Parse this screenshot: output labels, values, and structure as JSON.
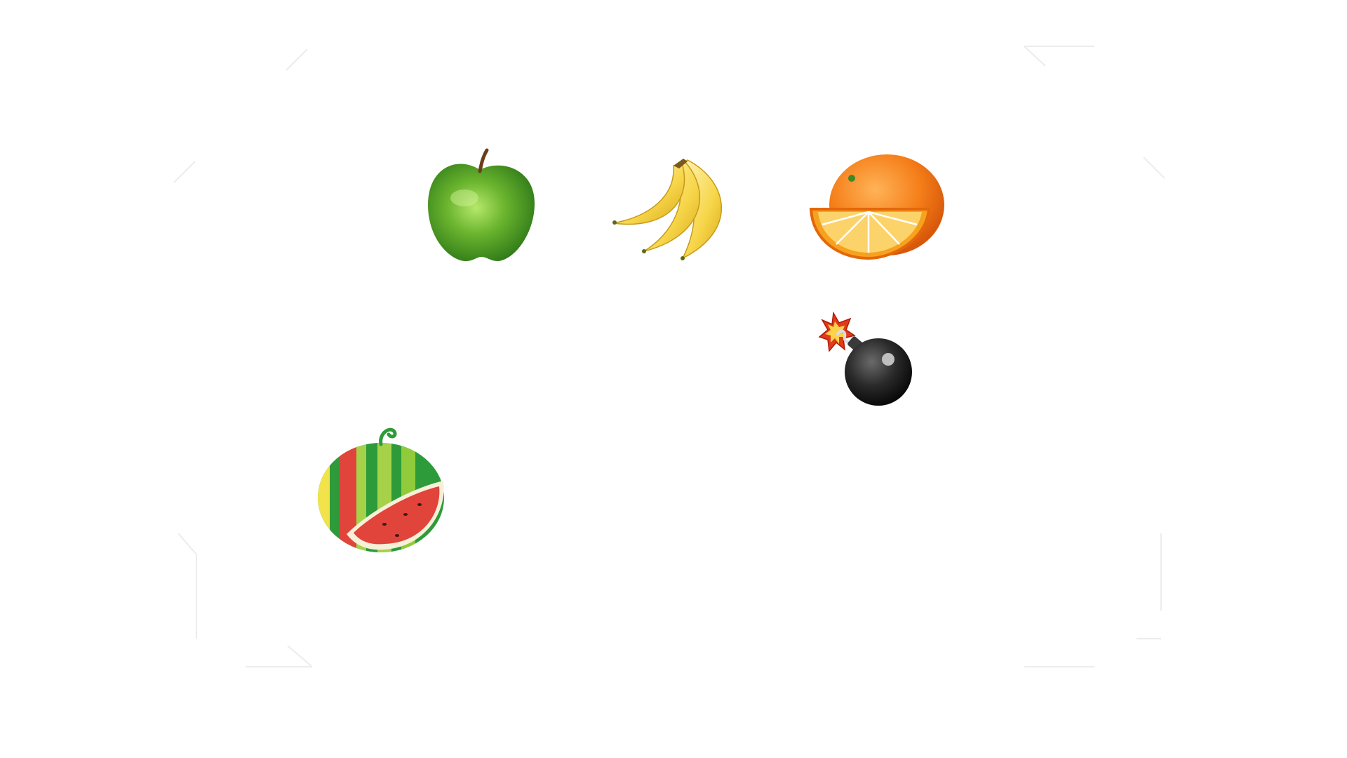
{
  "game": {
    "sprites": [
      {
        "kind": "fruit",
        "name": "apple",
        "icon": "green-apple-icon"
      },
      {
        "kind": "fruit",
        "name": "banana",
        "icon": "banana-bunch-icon"
      },
      {
        "kind": "fruit",
        "name": "orange",
        "icon": "orange-with-slice-icon"
      },
      {
        "kind": "hazard",
        "name": "bomb",
        "icon": "bomb-icon"
      },
      {
        "kind": "fruit",
        "name": "watermelon",
        "icon": "cut-watermelon-icon"
      }
    ]
  },
  "colors": {
    "background": "#ffffff",
    "apple_green": "#5aa827",
    "banana_yellow": "#f7d64a",
    "orange": "#f57f1a",
    "bomb_black": "#2a2a2a",
    "watermelon_green": "#2e9b3a",
    "watermelon_red": "#e0443a"
  }
}
